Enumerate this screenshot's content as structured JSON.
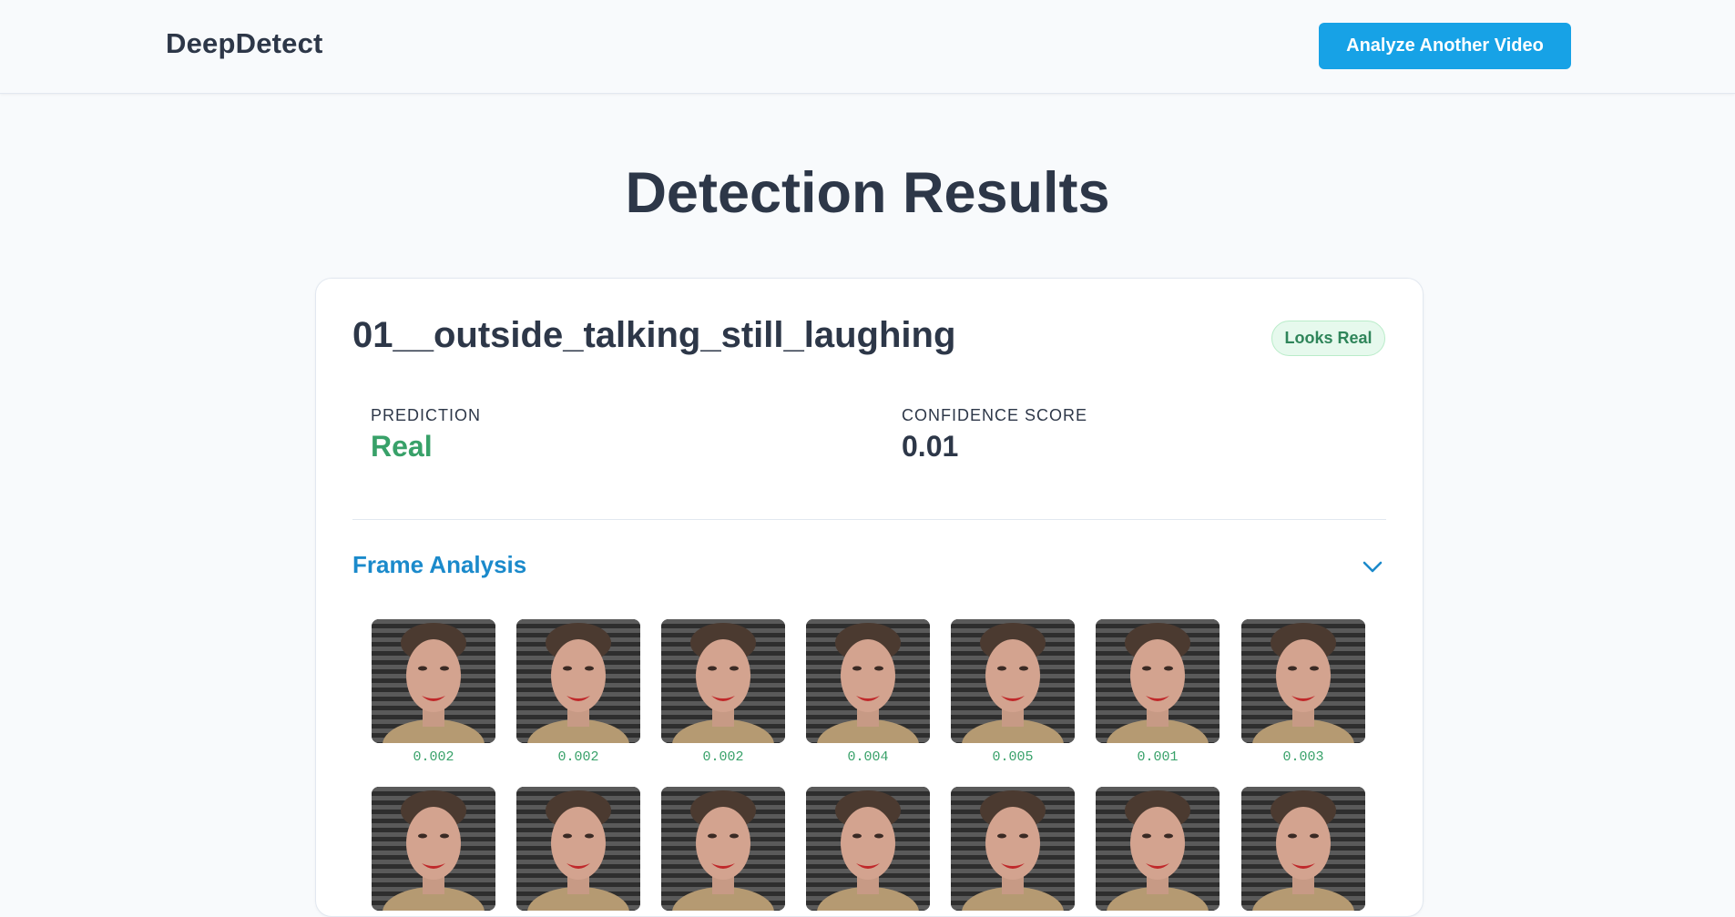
{
  "header": {
    "logo": "DeepDetect",
    "analyze_label": "Analyze Another Video"
  },
  "page_title": "Detection Results",
  "result": {
    "video_name": "01__outside_talking_still_laughing",
    "badge": "Looks Real",
    "prediction_label": "PREDICTION",
    "prediction_value": "Real",
    "confidence_label": "CONFIDENCE SCORE",
    "confidence_value": "0.01"
  },
  "frame_analysis": {
    "title": "Frame Analysis",
    "toggle_icon": "chevron-down-icon",
    "frames_row1": [
      {
        "score": "0.002"
      },
      {
        "score": "0.002"
      },
      {
        "score": "0.002"
      },
      {
        "score": "0.004"
      },
      {
        "score": "0.005"
      },
      {
        "score": "0.001"
      },
      {
        "score": "0.003"
      }
    ],
    "frames_row2": [
      {
        "score": ""
      },
      {
        "score": ""
      },
      {
        "score": ""
      },
      {
        "score": ""
      },
      {
        "score": ""
      },
      {
        "score": ""
      },
      {
        "score": ""
      }
    ]
  },
  "colors": {
    "accent": "#17a2e6",
    "real_green": "#38a169",
    "badge_bg": "#e6f9ed",
    "frame_title": "#1b8acb"
  }
}
